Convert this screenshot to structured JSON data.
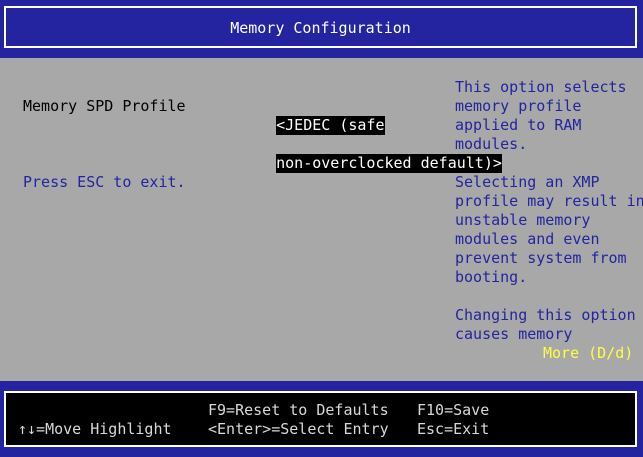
{
  "header": {
    "title": "Memory Configuration"
  },
  "settings": {
    "memory_spd_profile": {
      "label": "Memory SPD Profile",
      "value_line1": "<JEDEC (safe",
      "value_line2": "non-overclocked default)>"
    },
    "press_esc": "Press ESC to exit."
  },
  "help": {
    "block1": "This option selects\nmemory profile\napplied to RAM\nmodules.",
    "block2": "Selecting an XMP\nprofile may result in\nunstable memory\nmodules and even\nprevent system from\nbooting.",
    "block3": "Changing this option\ncauses memory",
    "more": "More (D/d)"
  },
  "footer": {
    "move": "↑↓=Move Highlight",
    "reset": "F9=Reset to Defaults",
    "select": "<Enter>=Select Entry",
    "save": "F10=Save",
    "exit": "Esc=Exit"
  },
  "colors": {
    "background": "#2424a0",
    "panel": "#a8a8a8",
    "highlight_text": "#2424a0",
    "more_indicator": "#ffff40",
    "selected_bg": "#000000"
  }
}
